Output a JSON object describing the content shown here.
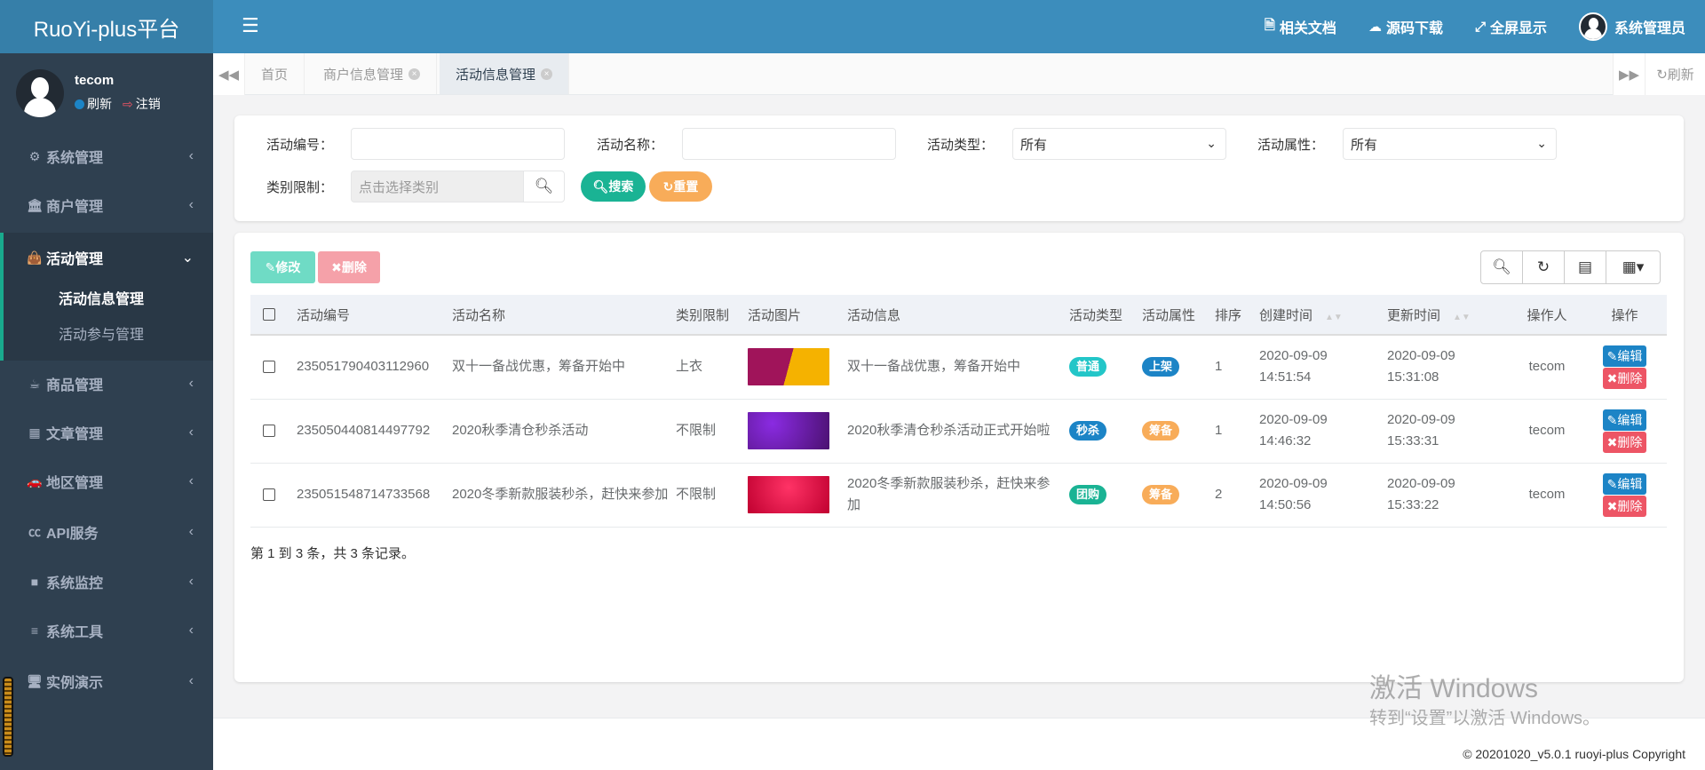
{
  "app": {
    "title": "RuoYi-plus平台"
  },
  "user": {
    "name": "tecom",
    "refresh": "刷新",
    "logout": "注销"
  },
  "sidebar": {
    "items": [
      {
        "label": "系统管理",
        "icon": "gear-icon"
      },
      {
        "label": "商户管理",
        "icon": "bank-icon"
      },
      {
        "label": "活动管理",
        "icon": "shopping-bag-icon"
      },
      {
        "label": "商品管理",
        "icon": "coffee-icon"
      },
      {
        "label": "文章管理",
        "icon": "calendar-icon"
      },
      {
        "label": "地区管理",
        "icon": "car-icon"
      },
      {
        "label": "API服务",
        "icon": "cc-icon"
      },
      {
        "label": "系统监控",
        "icon": "video-icon"
      },
      {
        "label": "系统工具",
        "icon": "bars-icon"
      },
      {
        "label": "实例演示",
        "icon": "desktop-icon"
      }
    ],
    "sub": [
      {
        "label": "活动信息管理"
      },
      {
        "label": "活动参与管理"
      }
    ]
  },
  "header": {
    "docs": "相关文档",
    "download": "源码下载",
    "fullscreen": "全屏显示",
    "admin": "系统管理员"
  },
  "tabs": [
    {
      "label": "首页"
    },
    {
      "label": "商户信息管理"
    },
    {
      "label": "活动信息管理"
    }
  ],
  "tabs_refresh": "刷新",
  "search": {
    "id_label": "活动编号：",
    "name_label": "活动名称：",
    "type_label": "活动类型：",
    "type_value": "所有",
    "attr_label": "活动属性：",
    "attr_value": "所有",
    "cat_label": "类别限制：",
    "cat_placeholder": "点击选择类别",
    "search_btn": "搜索",
    "reset_btn": "重置"
  },
  "toolbar": {
    "edit": "修改",
    "delete": "删除"
  },
  "table": {
    "headers": [
      "活动编号",
      "活动名称",
      "类别限制",
      "活动图片",
      "活动信息",
      "活动类型",
      "活动属性",
      "排序",
      "创建时间",
      "更新时间",
      "操作人",
      "操作"
    ],
    "rows": [
      {
        "id": "235051790403112960",
        "name": "双十一备战优惠，筹备开始中",
        "cat": "上衣",
        "info": "双十一备战优惠，筹备开始中",
        "type": "普通",
        "attr": "上架",
        "sort": "1",
        "created_date": "2020-09-09",
        "created_time": "14:51:54",
        "updated_date": "2020-09-09",
        "updated_time": "15:31:08",
        "operator": "tecom",
        "edit": "编辑",
        "del": "删除"
      },
      {
        "id": "235050440814497792",
        "name": "2020秋季清仓秒杀活动",
        "cat": "不限制",
        "info": "2020秋季清仓秒杀活动正式开始啦",
        "type": "秒杀",
        "attr": "筹备",
        "sort": "1",
        "created_date": "2020-09-09",
        "created_time": "14:46:32",
        "updated_date": "2020-09-09",
        "updated_time": "15:33:31",
        "operator": "tecom",
        "edit": "编辑",
        "del": "删除"
      },
      {
        "id": "235051548714733568",
        "name": "2020冬季新款服装秒杀，赶快来参加",
        "cat": "不限制",
        "info": "2020冬季新款服装秒杀，赶快来参加",
        "type": "团购",
        "attr": "筹备",
        "sort": "2",
        "created_date": "2020-09-09",
        "created_time": "14:50:56",
        "updated_date": "2020-09-09",
        "updated_time": "15:33:22",
        "operator": "tecom",
        "edit": "编辑",
        "del": "删除"
      }
    ]
  },
  "pagination": "第 1 到 3 条，共 3 条记录。",
  "footer": {
    "copyright": "© 20201020_v5.0.1 ruoyi-plus Copyright"
  },
  "watermark": {
    "line1": "激活 Windows",
    "line2": "转到“设置”以激活 Windows。"
  },
  "colors": {
    "primary": "#3c8dbc",
    "sidebar": "#2f4050",
    "green": "#1ab394",
    "orange": "#f8ac59",
    "red": "#ed5565",
    "blue": "#1c84c6",
    "teal": "#23c6c8"
  }
}
